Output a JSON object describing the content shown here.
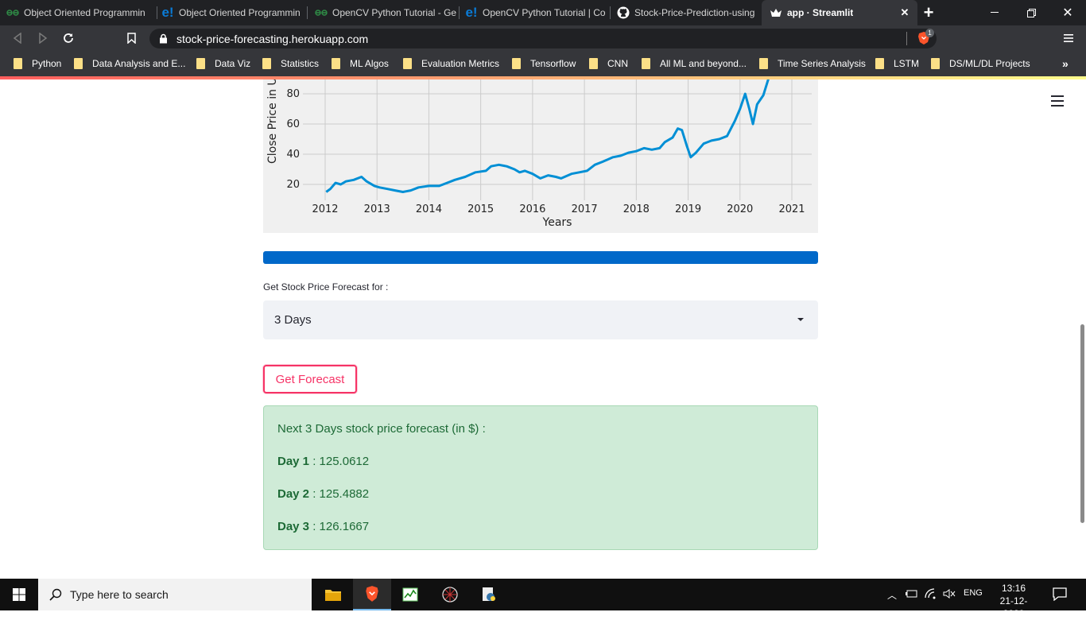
{
  "browser": {
    "tabs": [
      {
        "label": "Object Oriented Programmin",
        "icon": "geeksforgeeks-icon",
        "active": false
      },
      {
        "label": "Object Oriented Programmin",
        "icon": "edureka-icon",
        "active": false
      },
      {
        "label": "OpenCV Python Tutorial - Ge",
        "icon": "geeksforgeeks-icon",
        "active": false
      },
      {
        "label": "OpenCV Python Tutorial | Co",
        "icon": "edureka-icon",
        "active": false
      },
      {
        "label": "Stock-Price-Prediction-using",
        "icon": "github-icon",
        "active": false
      },
      {
        "label": "app · Streamlit",
        "icon": "streamlit-icon",
        "active": true
      }
    ],
    "url": "stock-price-forecasting.herokuapp.com",
    "brave_badge": "1",
    "bookmarks": [
      "Python",
      "Data Analysis and E...",
      "Data Viz",
      "Statistics",
      "ML Algos",
      "Evaluation Metrics",
      "Tensorflow",
      "CNN",
      "All ML and beyond...",
      "Time Series Analysis",
      "LSTM",
      "DS/ML/DL Projects"
    ],
    "colors": {
      "tabstrip": "#202124",
      "toolbar": "#35363a",
      "folder": "#fce087"
    }
  },
  "app": {
    "progress": 1.0,
    "select_label": "Get Stock Price Forecast for :",
    "select_value": "3 Days",
    "button_label": "Get Forecast",
    "result": {
      "title": "Next 3 Days stock price forecast (in $) :",
      "rows": [
        {
          "label": "Day 1",
          "value": " : 125.0612"
        },
        {
          "label": "Day 2",
          "value": " : 125.4882"
        },
        {
          "label": "Day 3",
          "value": " : 126.1667"
        }
      ]
    },
    "colors": {
      "primary": "#f63366",
      "progress": "#0068c9",
      "success_bg": "#cfebd7",
      "success_text": "#1d6a36"
    }
  },
  "chart_data": {
    "type": "line",
    "title": "",
    "xlabel": "Years",
    "ylabel": "Close Price in U",
    "x_ticks": [
      "2012",
      "2013",
      "2014",
      "2015",
      "2016",
      "2017",
      "2018",
      "2019",
      "2020",
      "2021"
    ],
    "y_ticks": [
      20,
      40,
      60,
      80
    ],
    "xlim": [
      2011.98,
      2021.4
    ],
    "ylim": [
      10,
      100
    ],
    "grid": true,
    "line_color": "#008fd5",
    "series": [
      {
        "x": [
          2012.02,
          2012.1,
          2012.2,
          2012.3,
          2012.4,
          2012.55,
          2012.7,
          2012.8,
          2012.95,
          2013.05,
          2013.2,
          2013.35,
          2013.5,
          2013.65,
          2013.8,
          2014.0,
          2014.2,
          2014.35,
          2014.5,
          2014.7,
          2014.9,
          2015.1,
          2015.2,
          2015.35,
          2015.5,
          2015.65,
          2015.75,
          2015.85,
          2016.0,
          2016.15,
          2016.3,
          2016.45,
          2016.55,
          2016.75,
          2016.9,
          2017.05,
          2017.2,
          2017.35,
          2017.55,
          2017.7,
          2017.85,
          2018.0,
          2018.15,
          2018.3,
          2018.45,
          2018.55,
          2018.7,
          2018.8,
          2018.88,
          2018.97,
          2019.05,
          2019.15,
          2019.3,
          2019.45,
          2019.6,
          2019.75,
          2019.9,
          2020.0,
          2020.1,
          2020.18,
          2020.25,
          2020.33,
          2020.45,
          2020.55
        ],
        "y": [
          15,
          17,
          21,
          20,
          22,
          23,
          25,
          22,
          19,
          18,
          17,
          16,
          15,
          16,
          18,
          19,
          19,
          21,
          23,
          25,
          28,
          29,
          32,
          33,
          32,
          30,
          28,
          29,
          27,
          24,
          26,
          25,
          24,
          27,
          28,
          29,
          33,
          35,
          38,
          39,
          41,
          42,
          44,
          43,
          44,
          48,
          51,
          57,
          56,
          46,
          38,
          41,
          47,
          49,
          50,
          52,
          62,
          70,
          80,
          70,
          60,
          73,
          79,
          90
        ]
      }
    ]
  }
}
